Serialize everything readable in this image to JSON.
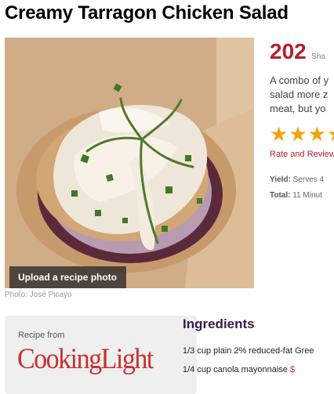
{
  "recipe": {
    "title": "Creamy Tarragon Chicken Salad",
    "upload_label": "Upload a recipe photo",
    "photo_credit": "Photo: José Picayo",
    "share_count": "202",
    "share_label": "Sha",
    "description_lines": [
      "A combo of y",
      "salad more z",
      "meat, but yo"
    ],
    "rating": {
      "stars_shown": 4,
      "max": 5
    },
    "rate_link": "Rate and Review",
    "yield_label": "Yield:",
    "yield_value": "Serves 4",
    "total_label": "Total:",
    "total_value": "11 Minut"
  },
  "source": {
    "label": "Recipe from",
    "logo_text": "CookingLight"
  },
  "ingredients": {
    "heading": "Ingredients",
    "items": [
      {
        "text": "1/3 cup plain 2% reduced-fat Gree",
        "price": ""
      },
      {
        "text": "1/4 cup canola mayonnaise ",
        "price": "$"
      }
    ]
  },
  "colors": {
    "accent_red": "#b3202c",
    "star": "#f4a20c",
    "heading_purple": "#3a1a4a"
  },
  "icons": [
    "star-icon"
  ]
}
